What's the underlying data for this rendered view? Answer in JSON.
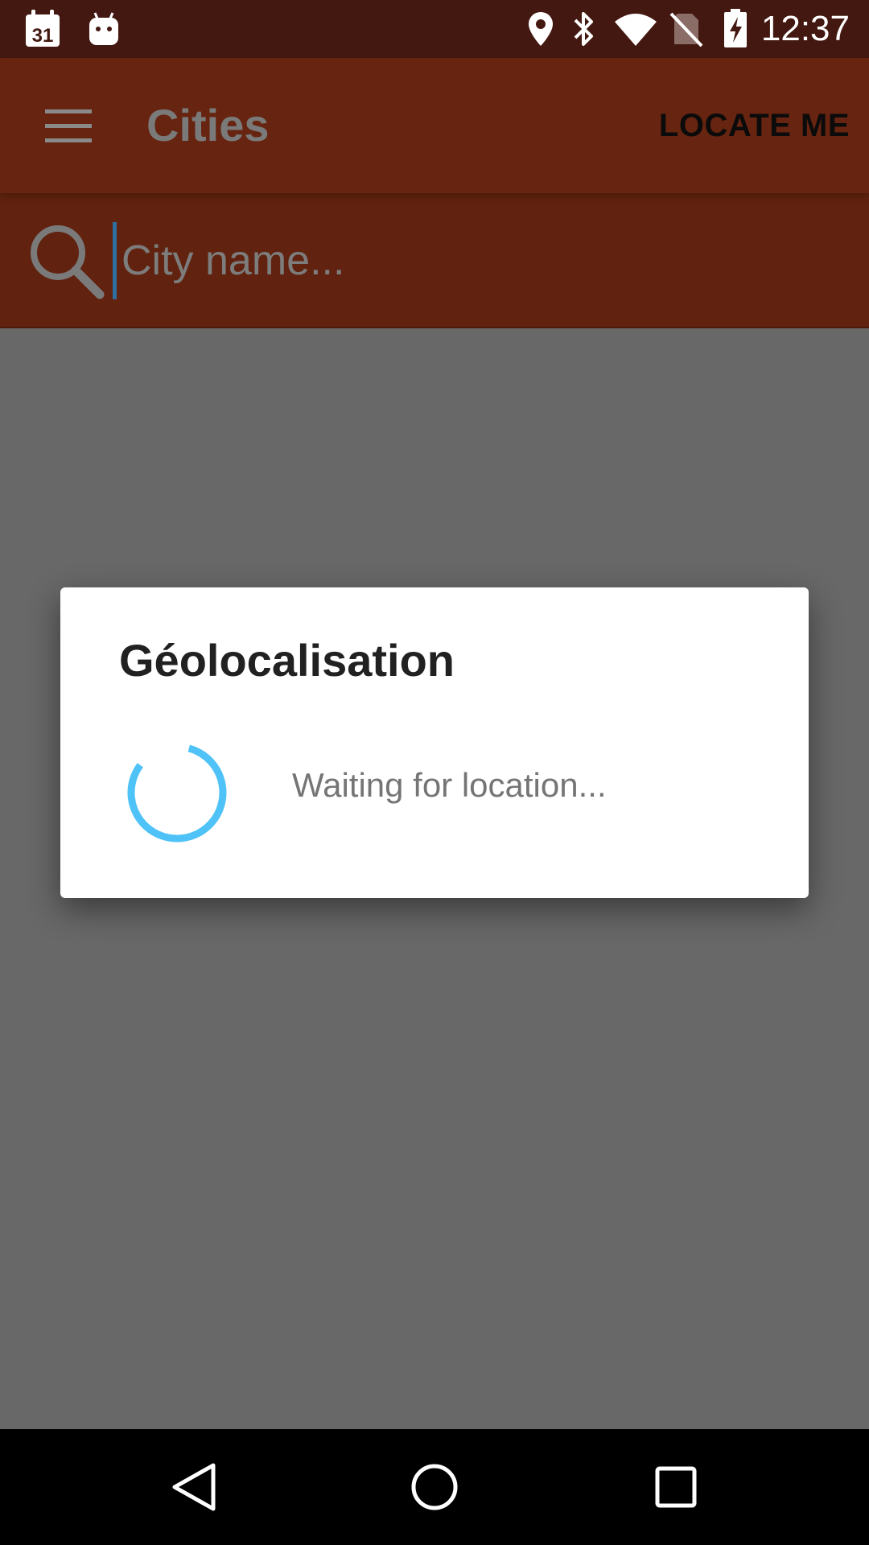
{
  "status_bar": {
    "time": "12:37",
    "calendar_day": "31",
    "icons": [
      "calendar-icon",
      "android-icon",
      "location-icon",
      "bluetooth-icon",
      "wifi-icon",
      "no-sim-icon",
      "battery-charging-icon"
    ]
  },
  "app_bar": {
    "title": "Cities",
    "locate_label": "LOCATE ME"
  },
  "search": {
    "placeholder": "City name...",
    "value": ""
  },
  "dialog": {
    "title": "Géolocalisation",
    "message": "Waiting for location...",
    "spinner_color": "#4fc3f7"
  },
  "colors": {
    "status_bar": "#431810",
    "app_bar": "#672410",
    "search_bar": "#61230f",
    "scrim_background": "#686868",
    "nav_bar": "#000000"
  }
}
